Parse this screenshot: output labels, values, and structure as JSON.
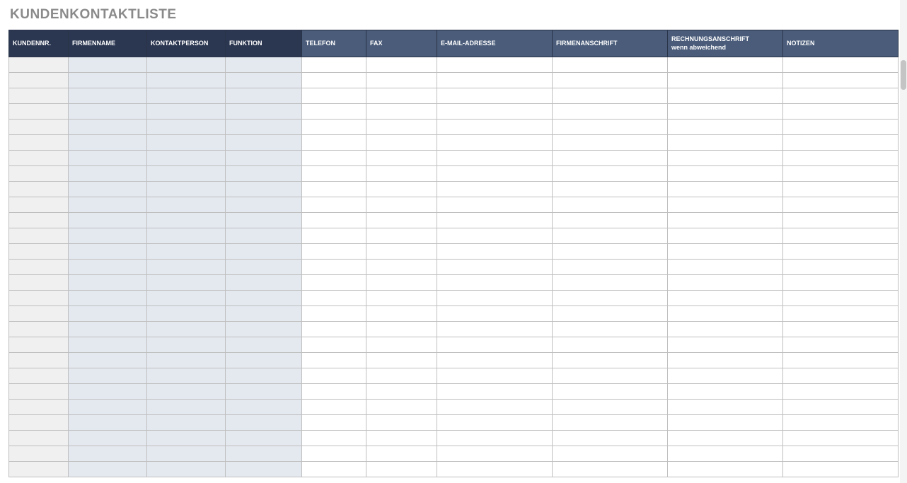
{
  "title": "KUNDENKONTAKTLISTE",
  "columns": [
    {
      "label": "KUNDENNR.",
      "style": "dark",
      "cell": "id",
      "cls": "col-0"
    },
    {
      "label": "FIRMENNAME",
      "style": "dark",
      "cell": "pale",
      "cls": "col-1"
    },
    {
      "label": "KONTAKTPERSON",
      "style": "dark",
      "cell": "pale",
      "cls": "col-2"
    },
    {
      "label": "FUNKTION",
      "style": "dark",
      "cell": "pale",
      "cls": "col-3"
    },
    {
      "label": "TELEFON",
      "style": "light",
      "cell": "white",
      "cls": "col-4"
    },
    {
      "label": "FAX",
      "style": "light",
      "cell": "white",
      "cls": "col-5"
    },
    {
      "label": "E-MAIL-ADRESSE",
      "style": "light",
      "cell": "white",
      "cls": "col-6"
    },
    {
      "label": "FIRMENANSCHRIFT",
      "style": "light",
      "cell": "white",
      "cls": "col-7"
    },
    {
      "label": "RECHNUNGSANSCHRIFT\nwenn abweichend",
      "style": "light",
      "cell": "white",
      "cls": "col-8"
    },
    {
      "label": "NOTIZEN",
      "style": "light",
      "cell": "white",
      "cls": "col-9"
    }
  ],
  "rows": [
    [
      "",
      "",
      "",
      "",
      "",
      "",
      "",
      "",
      "",
      ""
    ],
    [
      "",
      "",
      "",
      "",
      "",
      "",
      "",
      "",
      "",
      ""
    ],
    [
      "",
      "",
      "",
      "",
      "",
      "",
      "",
      "",
      "",
      ""
    ],
    [
      "",
      "",
      "",
      "",
      "",
      "",
      "",
      "",
      "",
      ""
    ],
    [
      "",
      "",
      "",
      "",
      "",
      "",
      "",
      "",
      "",
      ""
    ],
    [
      "",
      "",
      "",
      "",
      "",
      "",
      "",
      "",
      "",
      ""
    ],
    [
      "",
      "",
      "",
      "",
      "",
      "",
      "",
      "",
      "",
      ""
    ],
    [
      "",
      "",
      "",
      "",
      "",
      "",
      "",
      "",
      "",
      ""
    ],
    [
      "",
      "",
      "",
      "",
      "",
      "",
      "",
      "",
      "",
      ""
    ],
    [
      "",
      "",
      "",
      "",
      "",
      "",
      "",
      "",
      "",
      ""
    ],
    [
      "",
      "",
      "",
      "",
      "",
      "",
      "",
      "",
      "",
      ""
    ],
    [
      "",
      "",
      "",
      "",
      "",
      "",
      "",
      "",
      "",
      ""
    ],
    [
      "",
      "",
      "",
      "",
      "",
      "",
      "",
      "",
      "",
      ""
    ],
    [
      "",
      "",
      "",
      "",
      "",
      "",
      "",
      "",
      "",
      ""
    ],
    [
      "",
      "",
      "",
      "",
      "",
      "",
      "",
      "",
      "",
      ""
    ],
    [
      "",
      "",
      "",
      "",
      "",
      "",
      "",
      "",
      "",
      ""
    ],
    [
      "",
      "",
      "",
      "",
      "",
      "",
      "",
      "",
      "",
      ""
    ],
    [
      "",
      "",
      "",
      "",
      "",
      "",
      "",
      "",
      "",
      ""
    ],
    [
      "",
      "",
      "",
      "",
      "",
      "",
      "",
      "",
      "",
      ""
    ],
    [
      "",
      "",
      "",
      "",
      "",
      "",
      "",
      "",
      "",
      ""
    ],
    [
      "",
      "",
      "",
      "",
      "",
      "",
      "",
      "",
      "",
      ""
    ],
    [
      "",
      "",
      "",
      "",
      "",
      "",
      "",
      "",
      "",
      ""
    ],
    [
      "",
      "",
      "",
      "",
      "",
      "",
      "",
      "",
      "",
      ""
    ],
    [
      "",
      "",
      "",
      "",
      "",
      "",
      "",
      "",
      "",
      ""
    ],
    [
      "",
      "",
      "",
      "",
      "",
      "",
      "",
      "",
      "",
      ""
    ],
    [
      "",
      "",
      "",
      "",
      "",
      "",
      "",
      "",
      "",
      ""
    ],
    [
      "",
      "",
      "",
      "",
      "",
      "",
      "",
      "",
      "",
      ""
    ]
  ]
}
